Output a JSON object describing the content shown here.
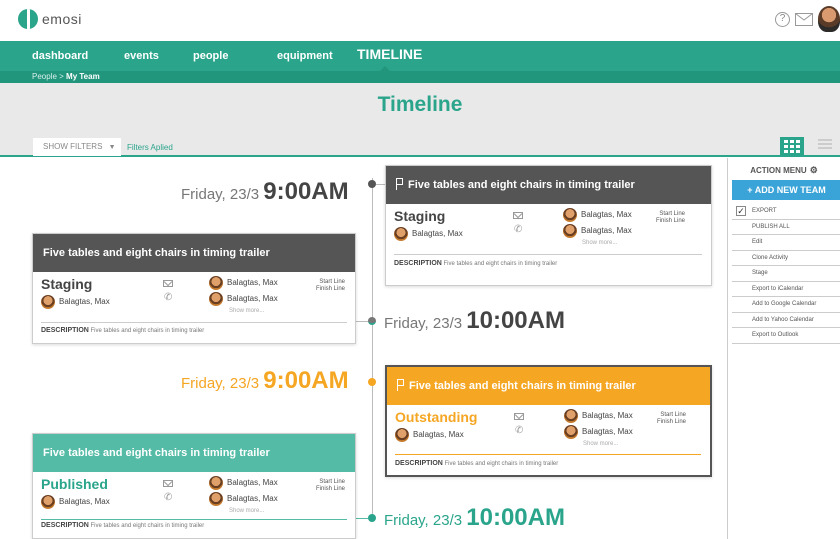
{
  "app": {
    "logo_text": "emosi"
  },
  "nav": {
    "items": [
      "dashboard",
      "events",
      "people",
      "equipment"
    ],
    "active": "TIMELINE"
  },
  "breadcrumb": {
    "parent": "People",
    "separator": " > ",
    "current": "My Team"
  },
  "page": {
    "title": "Timeline",
    "show_filters": "SHOW FILTERS",
    "filters_applied": "Filters Aplied"
  },
  "timeline": {
    "times": [
      {
        "day": "Friday, 23/3",
        "time": "9:00AM"
      },
      {
        "day": "Friday, 23/3",
        "time": "10:00AM"
      },
      {
        "day": "Friday, 23/3",
        "time": "9:00AM"
      },
      {
        "day": "Friday, 23/3",
        "time": "10:00AM"
      }
    ],
    "cards": [
      {
        "title": "Five tables and eight chairs in timing trailer",
        "status": "Staging",
        "lead": "Balagtas, Max",
        "people": [
          "Balagtas, Max",
          "Balagtas, Max"
        ],
        "show_more": "Show more...",
        "lines": [
          "Start Line",
          "Finish Line"
        ],
        "desc_label": "DESCRIPTION",
        "desc_text": "Five tables and eight chairs in timing trailer"
      },
      {
        "title": "Five tables and eight chairs in timing trailer",
        "status": "Staging",
        "lead": "Balagtas, Max",
        "people": [
          "Balagtas, Max",
          "Balagtas, Max"
        ],
        "show_more": "Show more...",
        "lines": [
          "Start Line",
          "Finish Line"
        ],
        "desc_label": "DESCRIPTION",
        "desc_text": "Five tables and eight chairs in timing trailer"
      },
      {
        "title": "Five tables and eight chairs in timing trailer",
        "status": "Outstanding",
        "lead": "Balagtas, Max",
        "people": [
          "Balagtas, Max",
          "Balagtas, Max"
        ],
        "show_more": "Show more...",
        "lines": [
          "Start Line",
          "Finish Line"
        ],
        "desc_label": "DESCRIPTION",
        "desc_text": "Five tables and eight chairs in timing trailer"
      },
      {
        "title": "Five tables and eight chairs in timing trailer",
        "status": "Published",
        "lead": "Balagtas, Max",
        "people": [
          "Balagtas, Max",
          "Balagtas, Max"
        ],
        "show_more": "Show more...",
        "lines": [
          "Start Line",
          "Finish Line"
        ],
        "desc_label": "DESCRIPTION",
        "desc_text": "Five tables and eight chairs in timing trailer"
      }
    ]
  },
  "action_menu": {
    "title": "ACTION MENU",
    "add_button": "+ ADD NEW TEAM",
    "items": [
      "EXPORT",
      "PUBLISH ALL",
      "Edit",
      "Clone Activity",
      "Stage",
      "Export to iCalendar",
      "Add to Google Calendar",
      "Add to Yahoo Calendar",
      "Export to Outlook"
    ],
    "export_checked": true
  },
  "colors": {
    "accent": "#2aa58c",
    "orange": "#f5a623",
    "dark": "#555555",
    "blue": "#3aa3d8"
  },
  "icons": [
    "help-icon",
    "mail-icon",
    "avatar",
    "gear-icon",
    "grid-view-icon",
    "list-view-icon",
    "flag-icon",
    "phone-icon",
    "chevron-down-icon"
  ]
}
